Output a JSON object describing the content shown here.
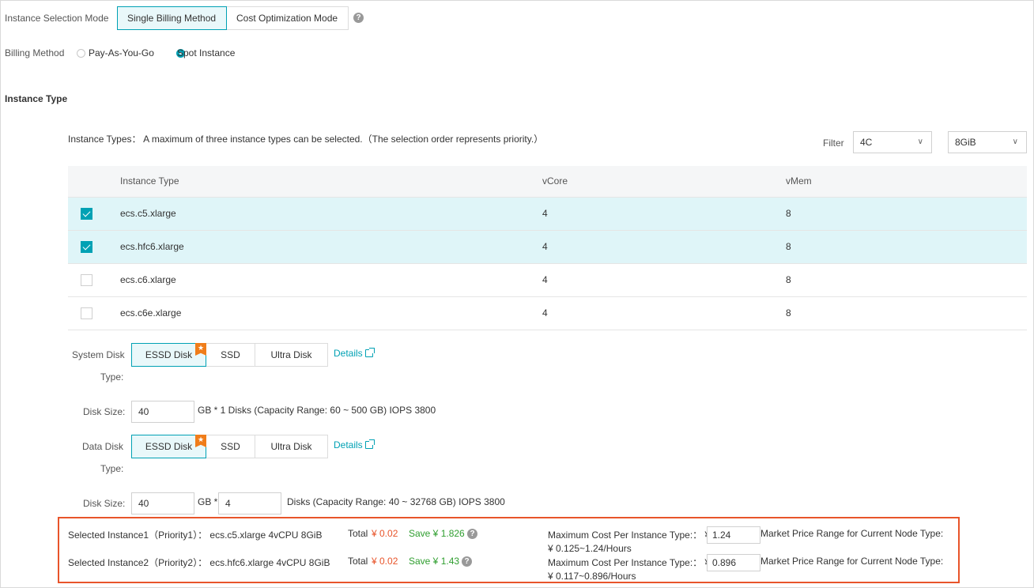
{
  "instance_selection": {
    "label": "Instance Selection Mode",
    "options": [
      "Single Billing Method",
      "Cost Optimization Mode"
    ],
    "selected": "Single Billing Method"
  },
  "billing": {
    "label": "Billing Method",
    "options": [
      "Pay-As-You-Go",
      "Spot Instance"
    ],
    "selected": "Spot Instance"
  },
  "instance_type": {
    "section_title": "Instance Type",
    "hint": "Instance Types： A maximum of three instance types can be selected.（The selection order represents priority.）",
    "filter_label": "Filter",
    "filter_cpu": "4C",
    "filter_mem": "8GiB",
    "columns": [
      "Instance Type",
      "vCore",
      "vMem"
    ],
    "rows": [
      {
        "name": "ecs.c5.xlarge",
        "vcore": "4",
        "vmem": "8",
        "checked": true
      },
      {
        "name": "ecs.hfc6.xlarge",
        "vcore": "4",
        "vmem": "8",
        "checked": true
      },
      {
        "name": "ecs.c6.xlarge",
        "vcore": "4",
        "vmem": "8",
        "checked": false
      },
      {
        "name": "ecs.c6e.xlarge",
        "vcore": "4",
        "vmem": "8",
        "checked": false
      }
    ]
  },
  "system_disk": {
    "label_line1": "System Disk",
    "label_line2": "Type:",
    "options": [
      "ESSD Disk",
      "SSD",
      "Ultra Disk"
    ],
    "selected": "ESSD Disk",
    "details": "Details",
    "size_label": "Disk Size:",
    "size_value": "40",
    "size_desc": "GB * 1 Disks (Capacity Range: 60 ~ 500 GB)  IOPS 3800"
  },
  "data_disk": {
    "label_line1": "Data Disk",
    "label_line2": "Type:",
    "options": [
      "ESSD Disk",
      "SSD",
      "Ultra Disk"
    ],
    "selected": "ESSD Disk",
    "details": "Details",
    "size_label": "Disk Size:",
    "size_value": "40",
    "gb_times": "GB *",
    "count_value": "4",
    "size_desc": "Disks (Capacity Range: 40 ~ 32768 GB)  IOPS 3800"
  },
  "summary": {
    "items": [
      {
        "label": "Selected Instance1（Priority1）： ecs.c5.xlarge 4vCPU 8GiB",
        "total_label": "Total",
        "total": "¥ 0.02",
        "save": "Save ¥ 1.826",
        "max_cost_label": "Maximum Cost Per Instance Type:： ¥",
        "max_cost_value": "1.24",
        "market_label": "Market Price Range for Current Node Type:",
        "market_range": "¥ 0.125~1.24/Hours"
      },
      {
        "label": "Selected Instance2（Priority2）： ecs.hfc6.xlarge 4vCPU 8GiB",
        "total_label": "Total",
        "total": "¥ 0.02",
        "save": "Save ¥ 1.43",
        "max_cost_label": "Maximum Cost Per Instance Type:： ¥",
        "max_cost_value": "0.896",
        "market_label": "Market Price Range for Current Node Type:",
        "market_range": "¥ 0.117~0.896/Hours"
      }
    ]
  },
  "colors": {
    "accent": "#00a1b4",
    "highlight_border": "#e8542a",
    "price_red": "#e8542a",
    "price_green": "#2f9e2f",
    "badge": "#f07d1a"
  },
  "icons": {
    "help": "?",
    "chevron": "∨",
    "star": "★"
  }
}
